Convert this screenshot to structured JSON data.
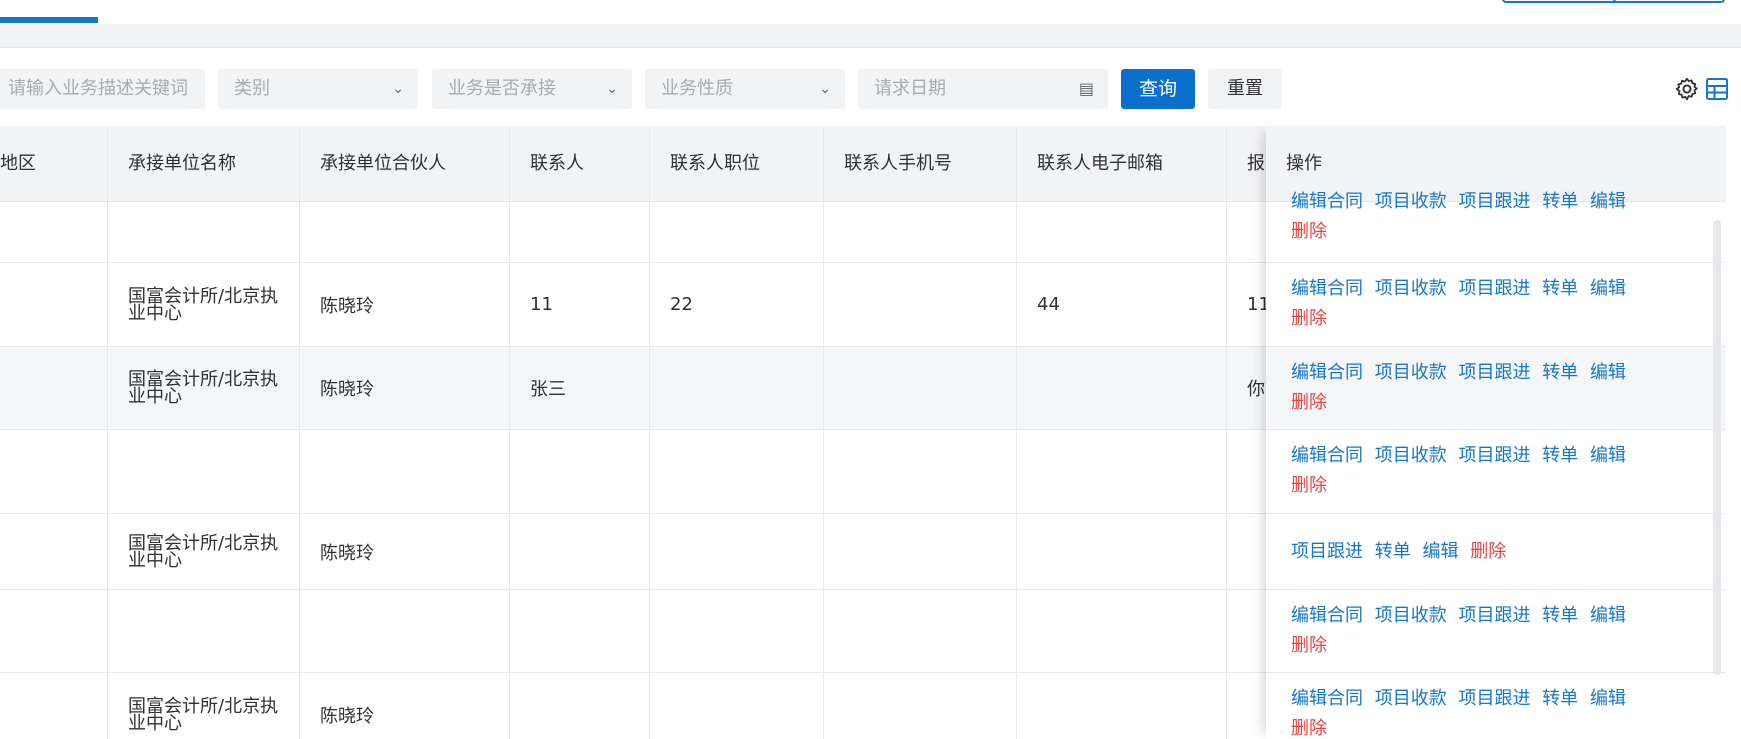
{
  "filters": {
    "keyword_placeholder": "请输入业务描述关键词",
    "category_placeholder": "类别",
    "accepted_placeholder": "业务是否承接",
    "nature_placeholder": "业务性质",
    "date_placeholder": "请求日期",
    "query_label": "查询",
    "reset_label": "重置"
  },
  "table": {
    "columns": [
      "地区",
      "承接单位名称",
      "承接单位合伙人",
      "联系人",
      "联系人职位",
      "联系人手机号",
      "联系人电子邮箱",
      "报"
    ],
    "ops_header": "操作",
    "rows": [
      {
        "unit": "",
        "partner": "",
        "contact": "",
        "position": "",
        "phone": "",
        "email": "",
        "extra": ""
      },
      {
        "unit": "国富会计所/北京执业中心",
        "partner": "陈晓玲",
        "contact": "11",
        "position": "22",
        "phone": "",
        "email": "44",
        "extra": "11"
      },
      {
        "unit": "国富会计所/北京执业中心",
        "partner": "陈晓玲",
        "contact": "张三",
        "position": "",
        "phone": "",
        "email": "",
        "extra": "你"
      },
      {
        "unit": "",
        "partner": "",
        "contact": "",
        "position": "",
        "phone": "",
        "email": "",
        "extra": ""
      },
      {
        "unit": "国富会计所/北京执业中心",
        "partner": "陈晓玲",
        "contact": "",
        "position": "",
        "phone": "",
        "email": "",
        "extra": ""
      },
      {
        "unit": "",
        "partner": "",
        "contact": "",
        "position": "",
        "phone": "",
        "email": "",
        "extra": ""
      },
      {
        "unit": "国富会计所/北京执业中心",
        "partner": "陈晓玲",
        "contact": "",
        "position": "",
        "phone": "",
        "email": "",
        "extra": ""
      }
    ]
  },
  "actions": {
    "edit_contract": "编辑合同",
    "collect": "项目收款",
    "follow": "项目跟进",
    "transfer": "转单",
    "edit": "编辑",
    "delete": "删除"
  },
  "icons": [
    "settings-gear-icon",
    "column-grid-icon",
    "chevron-down-icon",
    "calendar-icon"
  ],
  "colors": {
    "primary": "#0a6fcd",
    "link": "#1677c8",
    "danger": "#e64545"
  }
}
